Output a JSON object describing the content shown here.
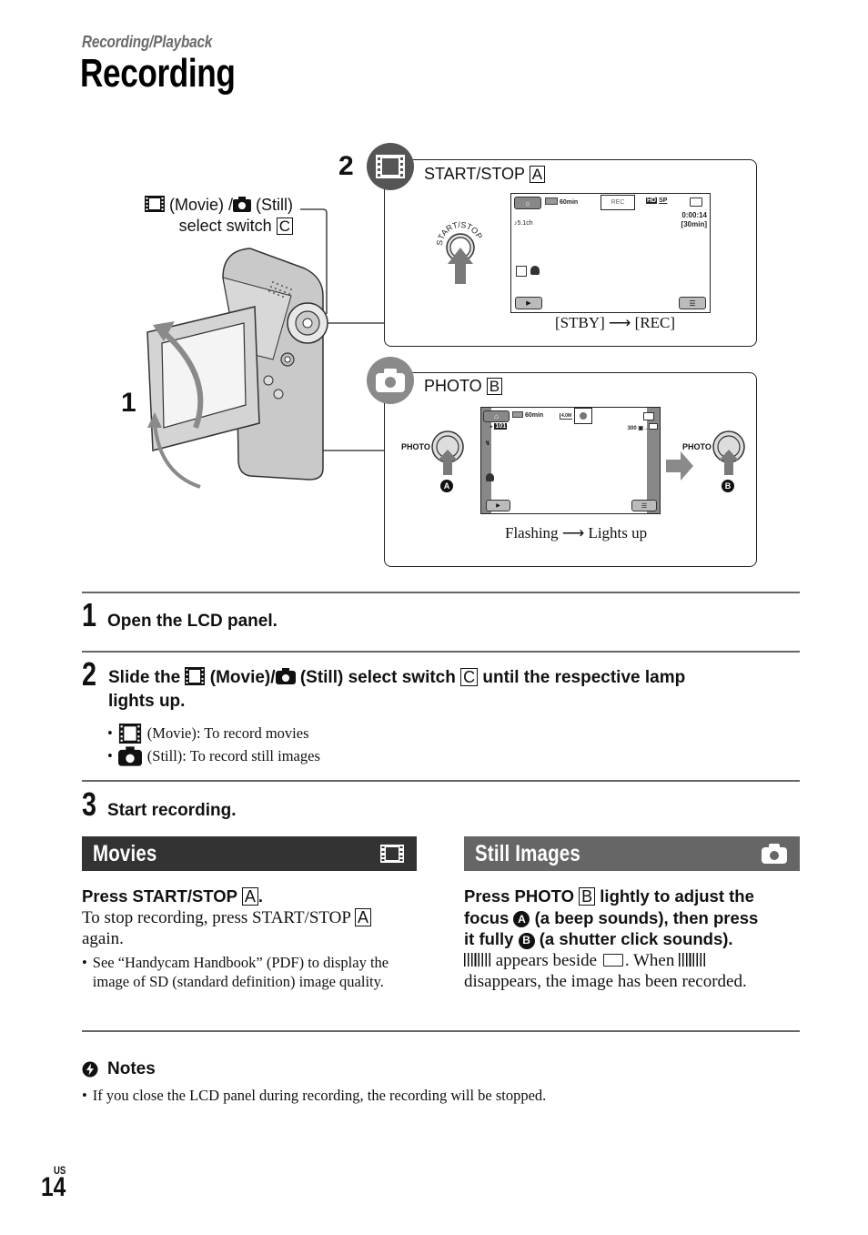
{
  "header": {
    "section": "Recording/Playback",
    "title": "Recording"
  },
  "diagram": {
    "switch_callout": {
      "movie": "(Movie) /",
      "still": "(Still)",
      "line2": "select switch",
      "letter": "C"
    },
    "step_markers": {
      "one": "1",
      "two": "2"
    },
    "movie_panel": {
      "title": "START/STOP",
      "letter": "A",
      "button_label": "START/STOP",
      "lcd": {
        "battery": "60min",
        "rec_indicator": "REC",
        "quality_hd": "HD",
        "quality_mode": "SP",
        "counter": "0:00:14",
        "remaining": "[30min]",
        "audio": "♪5.1ch"
      },
      "caption_from": "[STBY]",
      "caption_to": "[REC]"
    },
    "photo_panel": {
      "title": "PHOTO",
      "letter": "B",
      "lcd": {
        "battery": "60min",
        "image_size": "4.0M",
        "folder": "101",
        "shots": "300"
      },
      "left_button_label": "PHOTO",
      "right_button_label": "PHOTO",
      "left_marker": "A",
      "right_marker": "B",
      "caption_from": "Flashing",
      "caption_to": "Lights up"
    }
  },
  "steps": [
    {
      "num": "1",
      "text": "Open the LCD panel."
    },
    {
      "num": "2",
      "text_a": "Slide the",
      "text_b": "(Movie)/",
      "text_c": "(Still) select switch",
      "letter": "C",
      "text_d": "until the respective lamp",
      "text_e": "lights up.",
      "bullets": [
        {
          "icon": "movie-icon",
          "text": "(Movie): To record movies"
        },
        {
          "icon": "camera-icon",
          "text": "(Still): To record still images"
        }
      ]
    },
    {
      "num": "3",
      "text": "Start recording."
    }
  ],
  "movies": {
    "header": "Movies",
    "instruction": "Press START/STOP",
    "letter": "A",
    "body_a": "To stop recording, press START/STOP",
    "body_b": "again.",
    "bullet": "See “Handycam Handbook” (PDF) to display the image of SD (standard definition) image quality."
  },
  "still_images": {
    "header": "Still Images",
    "instr_1": "Press PHOTO",
    "letter": "B",
    "instr_2": "lightly to adjust the",
    "instr_3": "focus",
    "marker_a": "A",
    "instr_4": "(a beep sounds), then press",
    "instr_5": "it fully",
    "marker_b": "B",
    "instr_6": "(a shutter click sounds).",
    "body_1": "appears beside",
    "body_2": ". When",
    "body_3": "disappears, the image has been recorded."
  },
  "notes": {
    "title": "Notes",
    "items": [
      "If you close the LCD panel during recording, the recording will be stopped."
    ]
  },
  "footer": {
    "region": "US",
    "page": "14"
  },
  "colors": {
    "movies_header": "#333333",
    "still_header": "#666666",
    "badge_dark": "#555555",
    "badge_light": "#8a8a8a"
  }
}
